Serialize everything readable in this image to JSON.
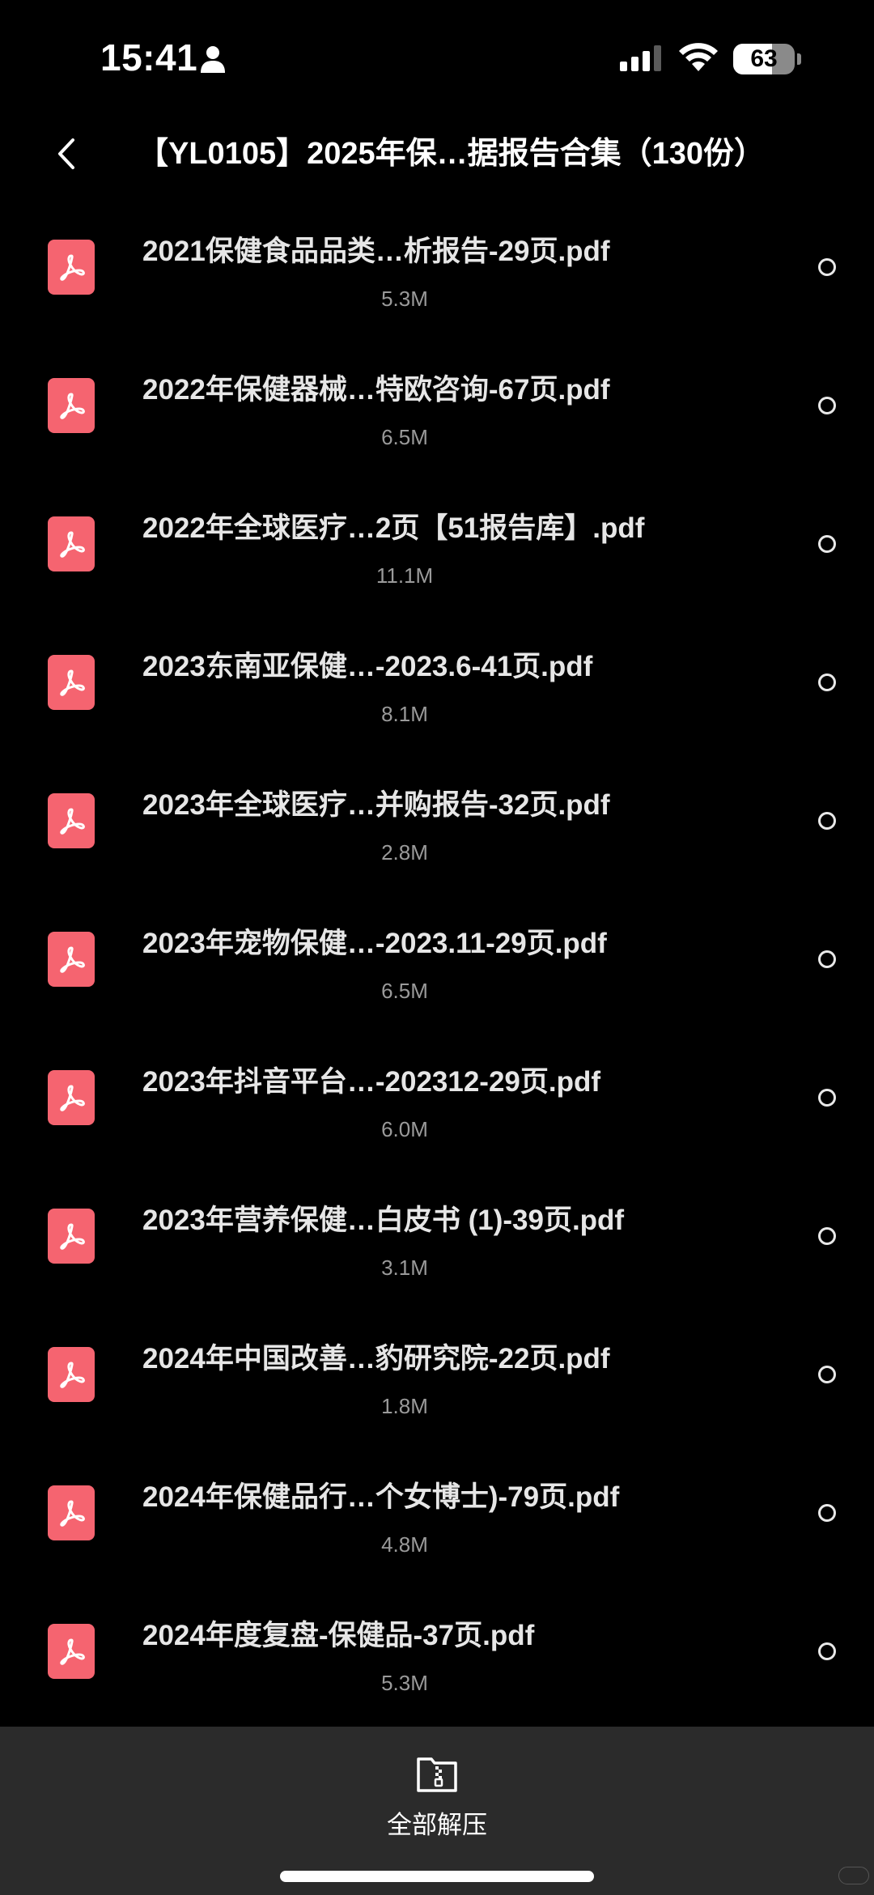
{
  "status_bar": {
    "time": "15:41",
    "battery_level": "63",
    "battery_fraction": 0.63
  },
  "header": {
    "title": "【YL0105】2025年保…据报告合集（130份）"
  },
  "files": [
    {
      "name": "2021保健食品品类…析报告-29页.pdf",
      "size": "5.3M"
    },
    {
      "name": "2022年保健器械…特欧咨询-67页.pdf",
      "size": "6.5M"
    },
    {
      "name": "2022年全球医疗…2页【51报告库】.pdf",
      "size": "11.1M"
    },
    {
      "name": "2023东南亚保健…-2023.6-41页.pdf",
      "size": "8.1M"
    },
    {
      "name": "2023年全球医疗…并购报告-32页.pdf",
      "size": "2.8M"
    },
    {
      "name": "2023年宠物保健…-2023.11-29页.pdf",
      "size": "6.5M"
    },
    {
      "name": "2023年抖音平台…-202312-29页.pdf",
      "size": "6.0M"
    },
    {
      "name": "2023年营养保健…白皮书 (1)-39页.pdf",
      "size": "3.1M"
    },
    {
      "name": "2024年中国改善…豹研究院-22页.pdf",
      "size": "1.8M"
    },
    {
      "name": "2024年保健品行…个女博士)-79页.pdf",
      "size": "4.8M"
    },
    {
      "name": "2024年度复盘-保健品-37页.pdf",
      "size": "5.3M"
    }
  ],
  "bottom_bar": {
    "extract_all_label": "全部解压"
  },
  "icons": {
    "file_type": "pdf-icon",
    "back": "chevron-left-icon",
    "extract": "zip-folder-icon"
  },
  "colors": {
    "background": "#000000",
    "pdf_icon": "#f56470",
    "bottom_bar": "#2b2b2b",
    "file_size_text": "#9a9a9a"
  }
}
